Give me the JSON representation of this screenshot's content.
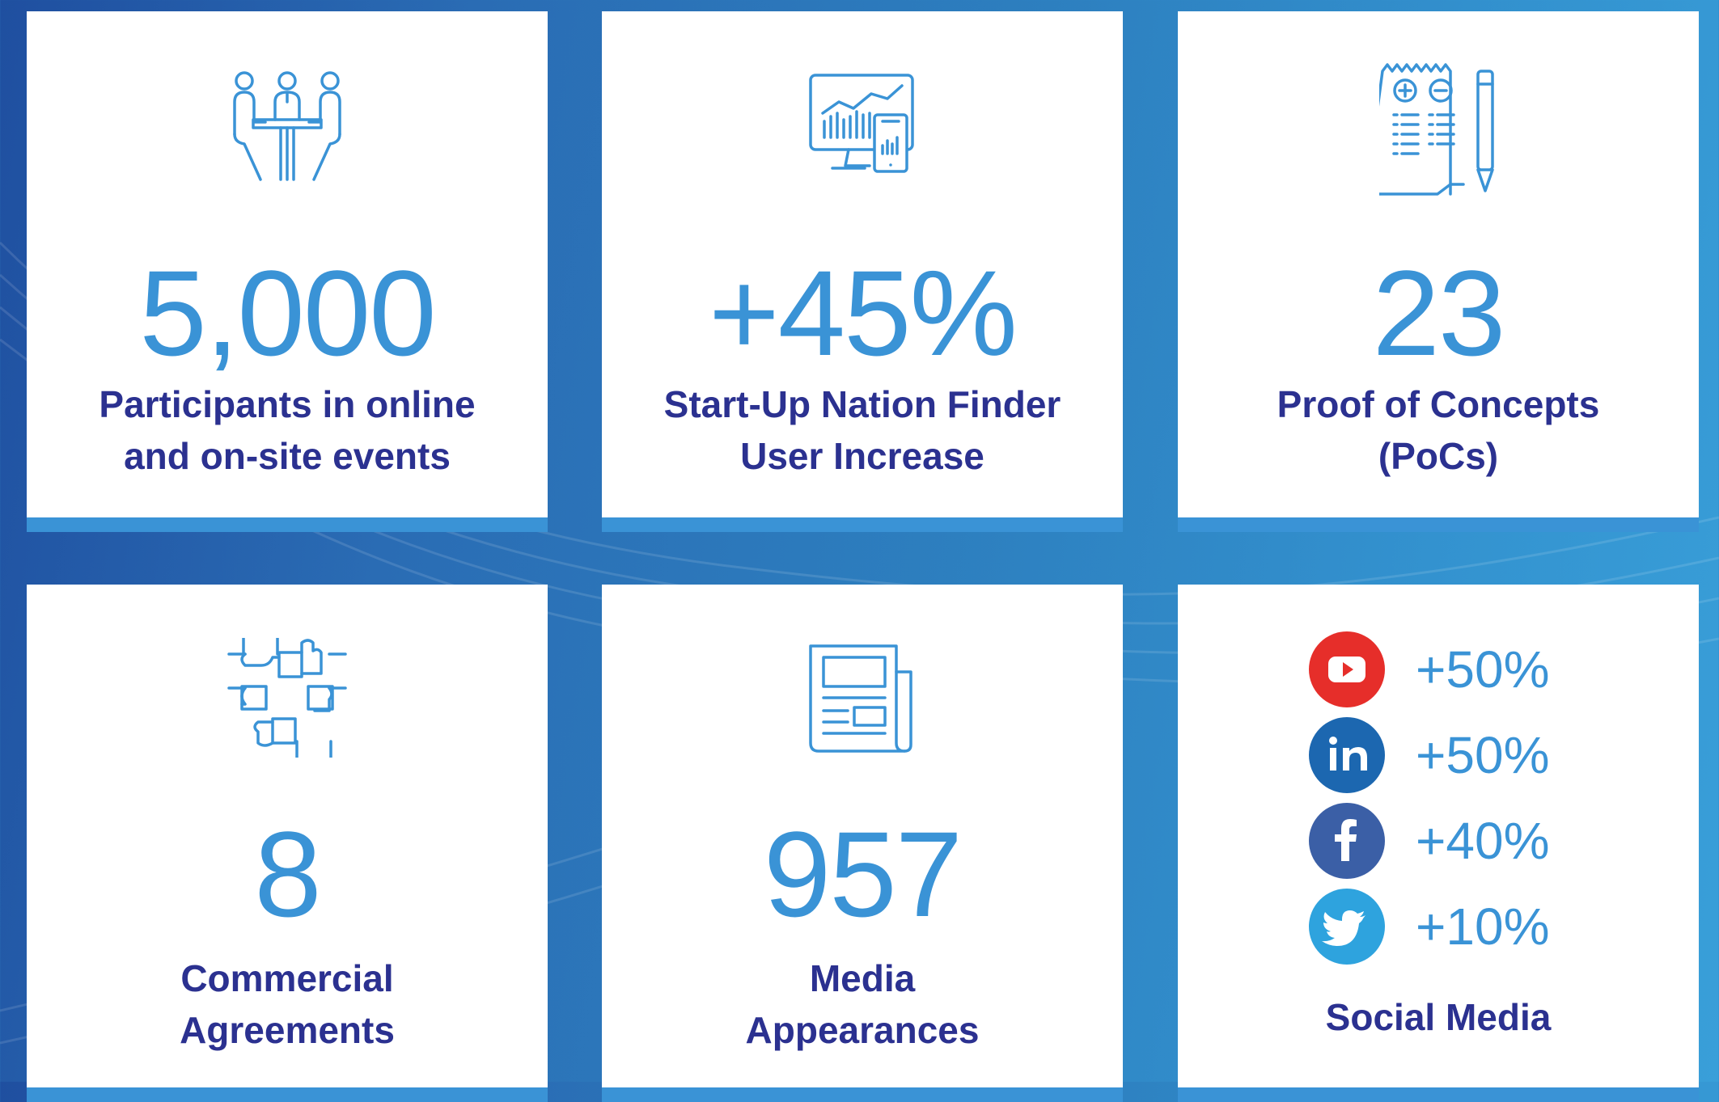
{
  "cards": [
    {
      "stat": "5,000",
      "label_line1": "Participants in online",
      "label_line2": "and on-site events",
      "icon": "meeting-icon"
    },
    {
      "stat": "+45%",
      "label_line1": "Start-Up Nation Finder",
      "label_line2": "User Increase",
      "icon": "analytics-screen-icon"
    },
    {
      "stat": "23",
      "label_line1": "Proof of Concepts",
      "label_line2": "(PoCs)",
      "icon": "document-pencil-icon"
    },
    {
      "stat": "8",
      "label_line1": "Commercial",
      "label_line2": "Agreements",
      "icon": "handshake-icon"
    },
    {
      "stat": "957",
      "label_line1": "Media",
      "label_line2": "Appearances",
      "icon": "newspaper-icon"
    }
  ],
  "social": {
    "label": "Social Media",
    "items": [
      {
        "network": "YouTube",
        "value": "+50%",
        "color": "#e62e2a",
        "icon": "youtube-icon"
      },
      {
        "network": "LinkedIn",
        "value": "+50%",
        "color": "#1c67b0",
        "icon": "linkedin-icon"
      },
      {
        "network": "Facebook",
        "value": "+40%",
        "color": "#3b5fa6",
        "icon": "facebook-icon"
      },
      {
        "network": "Twitter",
        "value": "+10%",
        "color": "#2ea3de",
        "icon": "twitter-icon"
      }
    ]
  },
  "colors": {
    "accent": "#3a93d6",
    "label": "#2b3190",
    "background": "#2d7fbf"
  }
}
